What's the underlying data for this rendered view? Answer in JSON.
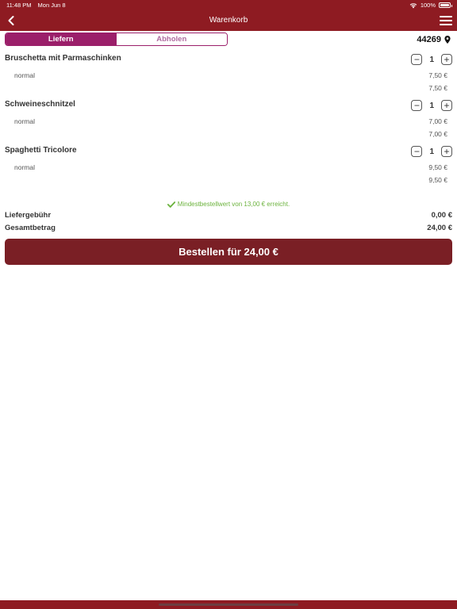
{
  "status": {
    "time": "11:48 PM",
    "date": "Mon Jun 8",
    "battery": "100%"
  },
  "header": {
    "title": "Warenkorb"
  },
  "tabs": {
    "deliver": "Liefern",
    "pickup": "Abholen"
  },
  "postal_code": "44269",
  "items": [
    {
      "name": "Bruschetta mit Parmaschinken",
      "qty": "1",
      "variant": "normal",
      "variant_price": "7,50 €",
      "total": "7,50 €"
    },
    {
      "name": "Schweineschnitzel",
      "qty": "1",
      "variant": "normal",
      "variant_price": "7,00 €",
      "total": "7,00 €"
    },
    {
      "name": "Spaghetti Tricolore",
      "qty": "1",
      "variant": "normal",
      "variant_price": "9,50 €",
      "total": "9,50 €"
    }
  ],
  "stepper": {
    "minus": "−",
    "plus": "+"
  },
  "notice": "Mindestbestellwert von 13,00 € erreicht.",
  "summary": {
    "delivery_label": "Liefergebühr",
    "delivery_value": "0,00 €",
    "total_label": "Gesamtbetrag",
    "total_value": "24,00 €"
  },
  "order_button": "Bestellen für 24,00 €",
  "colors": {
    "brand": "#8e1b22",
    "accent": "#9b1f6a",
    "button": "#7a1f25",
    "success": "#6cb33e"
  },
  "icons": {
    "back": "chevron-left-icon",
    "menu": "hamburger-menu-icon",
    "location": "map-pin-icon",
    "check": "checkmark-icon",
    "wifi": "wifi-icon",
    "battery": "battery-icon"
  }
}
